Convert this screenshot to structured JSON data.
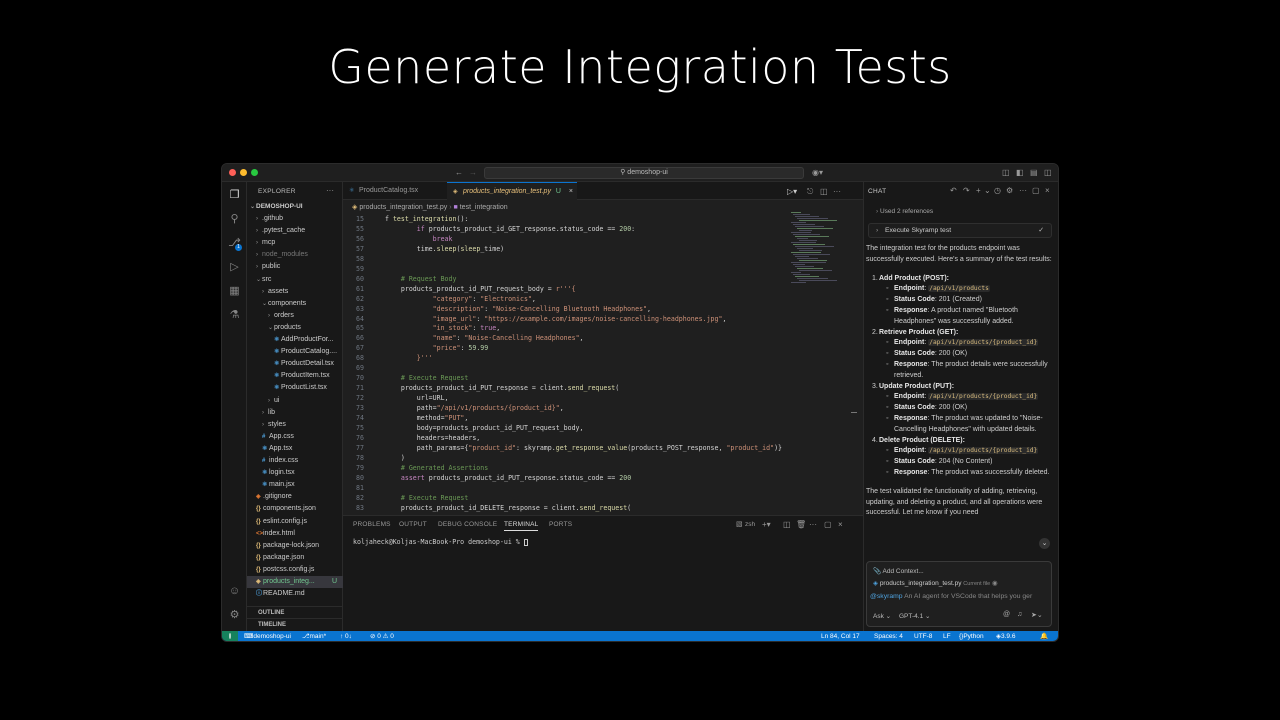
{
  "headline": "Generate Integration Tests",
  "window": {
    "search": "demoshop-ui"
  },
  "explorer": {
    "header": "EXPLORER",
    "more": "···",
    "root": "DEMOSHOP-UI",
    "items": [
      {
        "label": ".github",
        "type": "folder",
        "depth": 1,
        "state": "collapsed"
      },
      {
        "label": ".pytest_cache",
        "type": "folder",
        "depth": 1,
        "state": "collapsed"
      },
      {
        "label": "mcp",
        "type": "folder",
        "depth": 1,
        "state": "collapsed"
      },
      {
        "label": "node_modules",
        "type": "folder",
        "depth": 1,
        "state": "collapsed",
        "dim": true
      },
      {
        "label": "public",
        "type": "folder",
        "depth": 1,
        "state": "collapsed"
      },
      {
        "label": "src",
        "type": "folder",
        "depth": 1,
        "state": "expanded"
      },
      {
        "label": "assets",
        "type": "folder",
        "depth": 2,
        "state": "collapsed"
      },
      {
        "label": "components",
        "type": "folder",
        "depth": 2,
        "state": "expanded"
      },
      {
        "label": "orders",
        "type": "folder",
        "depth": 3,
        "state": "collapsed"
      },
      {
        "label": "products",
        "type": "folder",
        "depth": 3,
        "state": "expanded"
      },
      {
        "label": "AddProductFor...",
        "type": "tsx",
        "depth": 4
      },
      {
        "label": "ProductCatalog....",
        "type": "tsx",
        "depth": 4
      },
      {
        "label": "ProductDetail.tsx",
        "type": "tsx",
        "depth": 4
      },
      {
        "label": "ProductItem.tsx",
        "type": "tsx",
        "depth": 4
      },
      {
        "label": "ProductList.tsx",
        "type": "tsx",
        "depth": 4
      },
      {
        "label": "ui",
        "type": "folder",
        "depth": 3,
        "state": "collapsed"
      },
      {
        "label": "lib",
        "type": "folder",
        "depth": 2,
        "state": "collapsed"
      },
      {
        "label": "styles",
        "type": "folder",
        "depth": 2,
        "state": "collapsed"
      },
      {
        "label": "App.css",
        "type": "css",
        "depth": 2
      },
      {
        "label": "App.tsx",
        "type": "tsx",
        "depth": 2
      },
      {
        "label": "index.css",
        "type": "css",
        "depth": 2
      },
      {
        "label": "login.tsx",
        "type": "tsx",
        "depth": 2
      },
      {
        "label": "main.jsx",
        "type": "tsx",
        "depth": 2
      },
      {
        "label": ".gitignore",
        "type": "git",
        "depth": 1
      },
      {
        "label": "components.json",
        "type": "json",
        "depth": 1
      },
      {
        "label": "eslint.config.js",
        "type": "js",
        "depth": 1
      },
      {
        "label": "index.html",
        "type": "html",
        "depth": 1
      },
      {
        "label": "package-lock.json",
        "type": "json",
        "depth": 1
      },
      {
        "label": "package.json",
        "type": "json",
        "depth": 1
      },
      {
        "label": "postcss.config.js",
        "type": "js",
        "depth": 1
      },
      {
        "label": "products_integ...",
        "type": "py",
        "depth": 1,
        "selected": true,
        "status": "U"
      },
      {
        "label": "README.md",
        "type": "md",
        "depth": 1
      }
    ],
    "sections": [
      "OUTLINE",
      "TIMELINE"
    ]
  },
  "editor": {
    "tabs": [
      {
        "label": "ProductCatalog.tsx",
        "active": false,
        "status": ""
      },
      {
        "label": "products_integration_test.py",
        "active": true,
        "status": "U"
      }
    ],
    "breadcrumb": [
      "products_integration_test.py",
      "test_integration"
    ],
    "lines": [
      {
        "n": "15",
        "t": "f test_integration():"
      },
      {
        "n": "55",
        "t": "        if products_product_id_GET_response.status_code == 200:"
      },
      {
        "n": "56",
        "t": "            break"
      },
      {
        "n": "57",
        "t": "        time.sleep(sleep_time)"
      },
      {
        "n": "58",
        "t": ""
      },
      {
        "n": "59",
        "t": ""
      },
      {
        "n": "60",
        "t": "    # Request Body"
      },
      {
        "n": "61",
        "t": "    products_product_id_PUT_request_body = r'''{"
      },
      {
        "n": "62",
        "t": "            \"category\": \"Electronics\","
      },
      {
        "n": "63",
        "t": "            \"description\": \"Noise-Cancelling Bluetooth Headphones\","
      },
      {
        "n": "64",
        "t": "            \"image_url\": \"https://example.com/images/noise-cancelling-headphones.jpg\","
      },
      {
        "n": "65",
        "t": "            \"in_stock\": true,"
      },
      {
        "n": "66",
        "t": "            \"name\": \"Noise-Cancelling Headphones\","
      },
      {
        "n": "67",
        "t": "            \"price\": 59.99"
      },
      {
        "n": "68",
        "t": "        }'''"
      },
      {
        "n": "69",
        "t": ""
      },
      {
        "n": "70",
        "t": "    # Execute Request"
      },
      {
        "n": "71",
        "t": "    products_product_id_PUT_response = client.send_request("
      },
      {
        "n": "72",
        "t": "        url=URL,"
      },
      {
        "n": "73",
        "t": "        path=\"/api/v1/products/{product_id}\","
      },
      {
        "n": "74",
        "t": "        method=\"PUT\","
      },
      {
        "n": "75",
        "t": "        body=products_product_id_PUT_request_body,"
      },
      {
        "n": "76",
        "t": "        headers=headers,"
      },
      {
        "n": "77",
        "t": "        path_params={\"product_id\": skyramp.get_response_value(products_POST_response, \"product_id\")}"
      },
      {
        "n": "78",
        "t": "    )"
      },
      {
        "n": "79",
        "t": "    # Generated Assertions"
      },
      {
        "n": "80",
        "t": "    assert products_product_id_PUT_response.status_code == 200"
      },
      {
        "n": "81",
        "t": ""
      },
      {
        "n": "82",
        "t": "    # Execute Request"
      },
      {
        "n": "83",
        "t": "    products_product_id_DELETE_response = client.send_request("
      }
    ]
  },
  "panel": {
    "tabs": [
      "PROBLEMS",
      "OUTPUT",
      "DEBUG CONSOLE",
      "TERMINAL",
      "PORTS"
    ],
    "active_tab": "TERMINAL",
    "shell": "zsh",
    "prompt": "koljaheck@Koljas-MacBook-Pro demoshop-ui % "
  },
  "chat": {
    "title": "CHAT",
    "references": "Used 2 references",
    "tool": "Execute Skyramp test",
    "intro": "The integration test for the products endpoint was successfully executed. Here's a summary of the test results:",
    "steps": [
      {
        "num": "1.",
        "title": "Add Product (POST):",
        "endpoint": "/api/v1/products",
        "status": "201 (Created)",
        "response": "A product named \"Bluetooth Headphones\" was successfully added."
      },
      {
        "num": "2.",
        "title": "Retrieve Product (GET):",
        "endpoint": "/api/v1/products/{product_id}",
        "status": "200 (OK)",
        "response": "The product details were successfully retrieved."
      },
      {
        "num": "3.",
        "title": "Update Product (PUT):",
        "endpoint": "/api/v1/products/{product_id}",
        "status": "200 (OK)",
        "response": "The product was updated to \"Noise-Cancelling Headphones\" with updated details."
      },
      {
        "num": "4.",
        "title": "Delete Product (DELETE):",
        "endpoint": "/api/v1/products/{product_id}",
        "status": "204 (No Content)",
        "response": "The product was successfully deleted."
      }
    ],
    "labels": {
      "endpoint": "Endpoint",
      "status": "Status Code",
      "response": "Response"
    },
    "outro": "The test validated the functionality of adding, retrieving, updating, and deleting a product, and all operations were successful. Let me know if you need",
    "input": {
      "add_context": "Add Context...",
      "file": "products_integration_test.py",
      "file_tag": "Current file",
      "mention": "@skyramp",
      "placeholder": "An AI agent for VSCode that helps you ger",
      "mode": "Ask",
      "model": "GPT-4.1"
    }
  },
  "status": {
    "branch": "main*",
    "sync": "↑ 0↓",
    "problems": "⊘ 0 ⚠ 0",
    "position": "Ln 84, Col 17",
    "spaces": "Spaces: 4",
    "encoding": "UTF-8",
    "eol": "LF",
    "language": "Python",
    "version": "3.9.6",
    "workspace": "demoshop-ui"
  }
}
